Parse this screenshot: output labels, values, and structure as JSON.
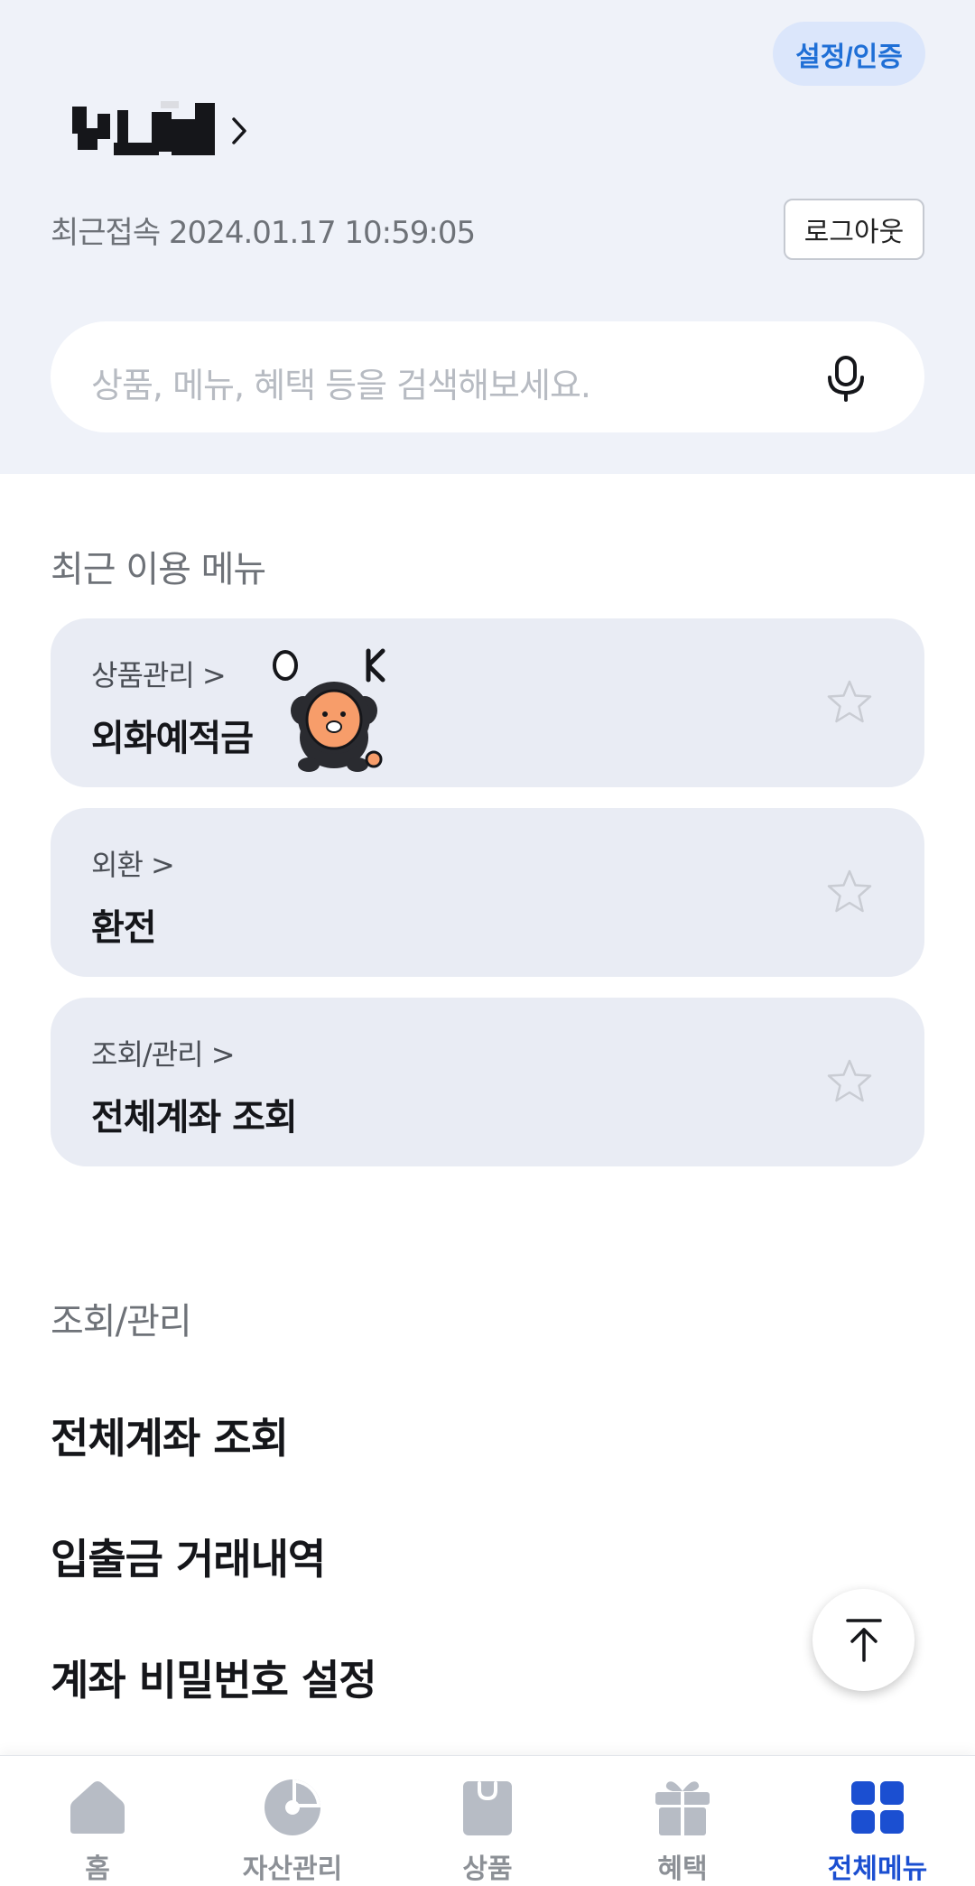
{
  "header": {
    "settings_label": "설정/인증",
    "last_login": "최근접속 2024.01.17 10:59:05",
    "logout_label": "로그아웃"
  },
  "search": {
    "placeholder": "상품, 메뉴, 혜택 등을 검색해보세요."
  },
  "recent": {
    "title": "최근 이용 메뉴",
    "items": [
      {
        "category": "상품관리 >",
        "title": "외화예적금"
      },
      {
        "category": "외환 >",
        "title": "환전"
      },
      {
        "category": "조회/관리 >",
        "title": "전체계좌 조회"
      }
    ]
  },
  "sticker_text": "O K",
  "inquiry_section": {
    "title": "조회/관리",
    "links": [
      "전체계좌 조회",
      "입출금 거래내역",
      "계좌 비밀번호 설정"
    ]
  },
  "bottom_nav": {
    "items": [
      {
        "label": "홈",
        "icon": "home-icon"
      },
      {
        "label": "자산관리",
        "icon": "pie-chart-icon"
      },
      {
        "label": "상품",
        "icon": "shopping-bag-icon"
      },
      {
        "label": "혜택",
        "icon": "gift-icon"
      },
      {
        "label": "전체메뉴",
        "icon": "grid-menu-icon"
      }
    ],
    "active_index": 4
  },
  "colors": {
    "header_bg": "#eff2f9",
    "accent": "#1f6fd6",
    "nav_active": "#1b4fd1",
    "nav_inactive": "#8c9096",
    "card_bg": "#e9ecf4"
  }
}
